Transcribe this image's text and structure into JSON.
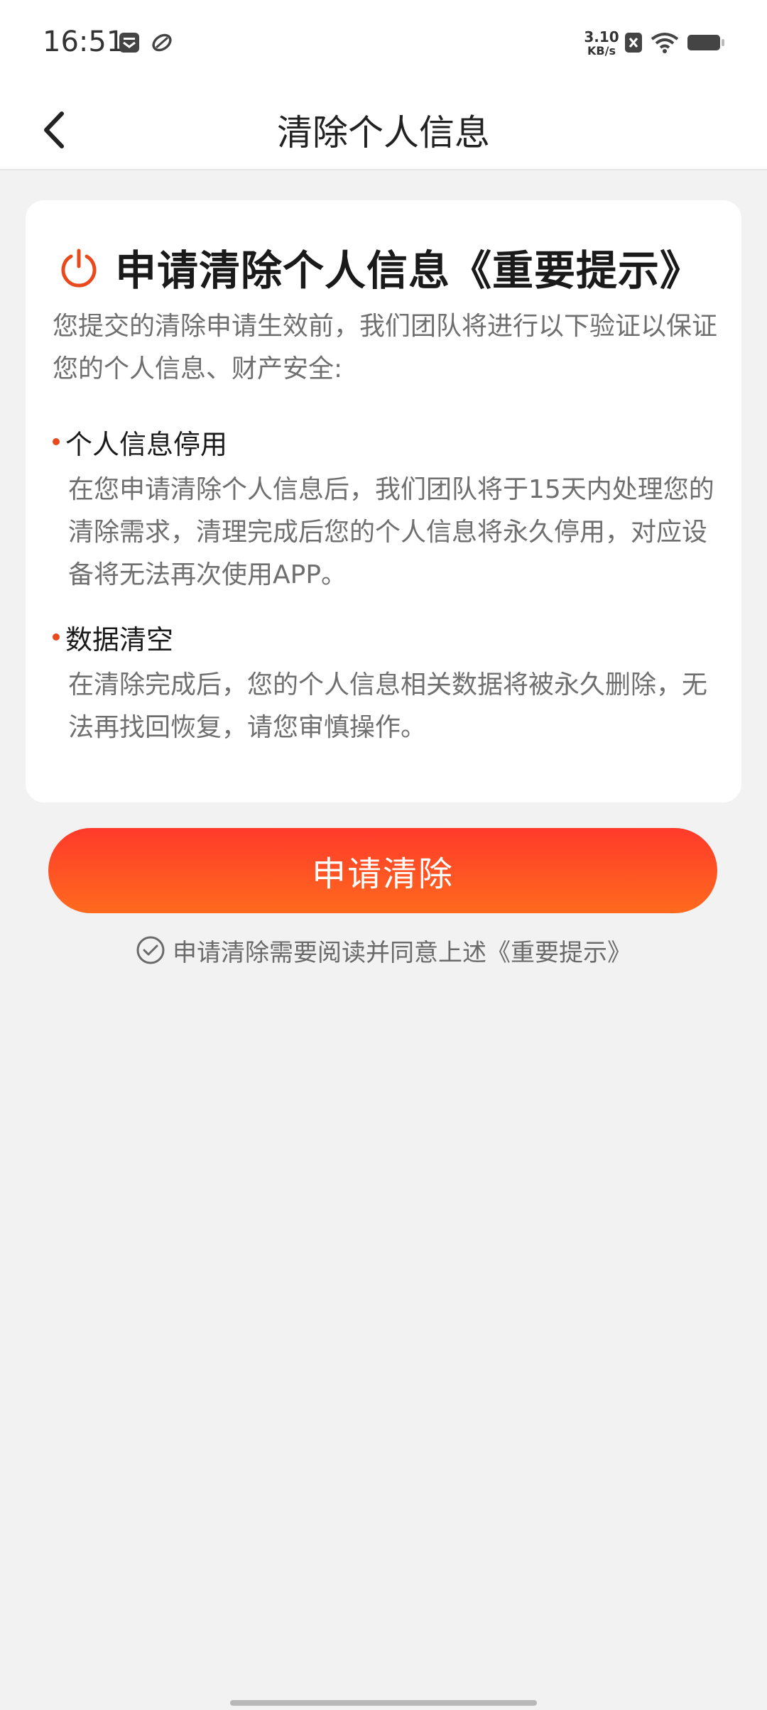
{
  "status_bar": {
    "time": "16:51",
    "net_speed_value": "3.10",
    "net_speed_unit": "KB/s",
    "icons": [
      "notification-box-icon",
      "app-leaf-icon",
      "sim-x-icon",
      "wifi-icon",
      "battery-icon"
    ]
  },
  "header": {
    "title": "清除个人信息",
    "back_icon": "chevron-left-icon"
  },
  "card": {
    "icon": "power-icon",
    "title": "申请清除个人信息《重要提示》",
    "intro": "您提交的清除申请生效前，我们团队将进行以下验证以保证您的个人信息、财产安全:",
    "sections": [
      {
        "title": "个人信息停用",
        "body": "在您申请清除个人信息后，我们团队将于15天内处理您的清除需求，清理完成后您的个人信息将永久停用，对应设备将无法再次使用APP。"
      },
      {
        "title": "数据清空",
        "body": "在清除完成后，您的个人信息相关数据将被永久删除，无法再找回恢复，请您审慎操作。"
      }
    ]
  },
  "actions": {
    "apply_label": "申请清除",
    "agreement_text": "申请清除需要阅读并同意上述《重要提示》",
    "agreement_icon": "check-circle-icon"
  },
  "colors": {
    "accent": "#ff4a24",
    "bullet": "#e8491d",
    "background": "#f2f2f2"
  }
}
